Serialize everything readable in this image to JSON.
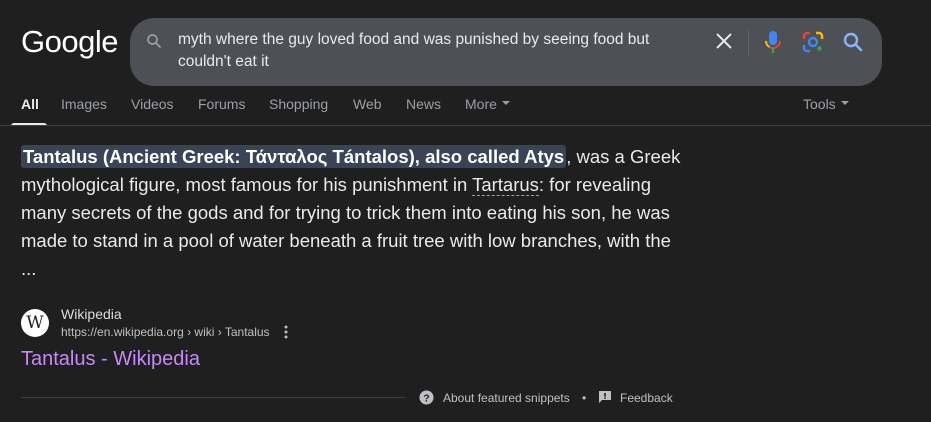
{
  "logo": {
    "text": "Google"
  },
  "search": {
    "query": "myth where the guy loved food and was punished by seeing food but couldn't eat it",
    "icons": [
      "search-icon",
      "clear-icon",
      "microphone-icon",
      "lens-icon",
      "search-submit-icon"
    ]
  },
  "tabs": [
    {
      "label": "All",
      "active": true
    },
    {
      "label": "Images"
    },
    {
      "label": "Videos"
    },
    {
      "label": "Forums"
    },
    {
      "label": "Shopping"
    },
    {
      "label": "Web"
    },
    {
      "label": "News"
    },
    {
      "label": "More",
      "icon": "caret-down-icon"
    }
  ],
  "tools": {
    "label": "Tools",
    "icon": "caret-down-icon"
  },
  "snippet": {
    "highlighted": "Tantalus (Ancient Greek: Τάνταλος Tántalos), also called Atys",
    "text_part1": ", was a Greek mythological figure, most famous for his punishment in ",
    "tartarus_link": "Tartarus",
    "text_part2": ": for revealing many secrets of the gods and for trying to trick them into eating his son, he was made to stand in a pool of water beneath a fruit tree with low branches, with the ..."
  },
  "source": {
    "favicon_letter": "W",
    "name": "Wikipedia",
    "url": "https://en.wikipedia.org › wiki › Tantalus",
    "title": "Tantalus - Wikipedia"
  },
  "footer": {
    "about_label": "About featured snippets",
    "separator": "•",
    "feedback_label": "Feedback"
  },
  "colors": {
    "background": "#1f1f1f",
    "search_box": "#4d5156",
    "highlight": "#394457",
    "visited_link": "#c58af9"
  }
}
